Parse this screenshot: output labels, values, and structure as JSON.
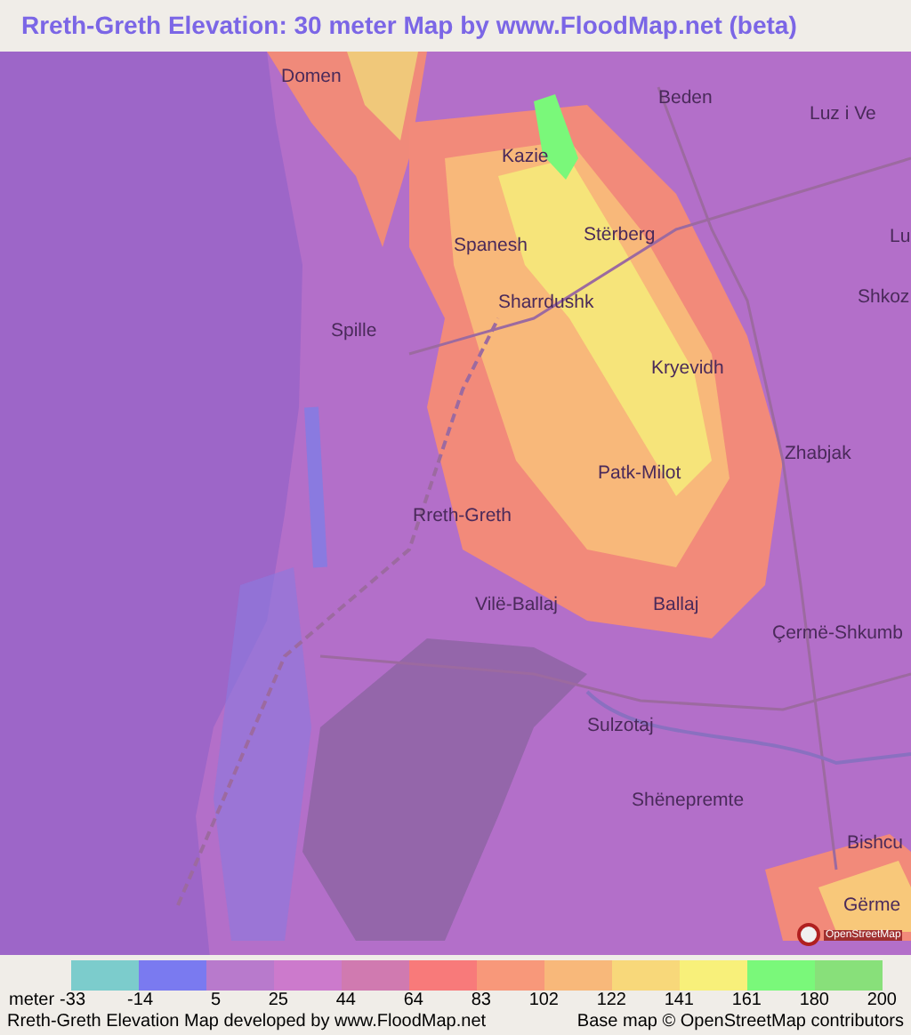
{
  "title": "Rreth-Greth Elevation: 30 meter Map by www.FloodMap.net (beta)",
  "map": {
    "places": [
      {
        "name": "Domen"
      },
      {
        "name": "Beden"
      },
      {
        "name": "Luz i Ve"
      },
      {
        "name": "Kazie"
      },
      {
        "name": "Lu"
      },
      {
        "name": "Spanesh"
      },
      {
        "name": "Stërberg"
      },
      {
        "name": "Shkoz"
      },
      {
        "name": "Sharrdushk"
      },
      {
        "name": "Spille"
      },
      {
        "name": "Kryevidh"
      },
      {
        "name": "Zhabjak"
      },
      {
        "name": "Patk-Milot"
      },
      {
        "name": "Rreth-Greth"
      },
      {
        "name": "Vilë-Ballaj"
      },
      {
        "name": "Ballaj"
      },
      {
        "name": "Çermë-Shkumb"
      },
      {
        "name": "Sulzotaj"
      },
      {
        "name": "Shënepremte"
      },
      {
        "name": "Bishcu"
      },
      {
        "name": "Gërme"
      }
    ],
    "attribution_logo": "OpenStreetMap"
  },
  "legend": {
    "unit": "meter",
    "swatches": [
      {
        "color": "#7ccccc"
      },
      {
        "color": "#7a7af0"
      },
      {
        "color": "#b87acc"
      },
      {
        "color": "#cc7acc"
      },
      {
        "color": "#d07ab0"
      },
      {
        "color": "#f87a7a"
      },
      {
        "color": "#f8987a"
      },
      {
        "color": "#f8b87a"
      },
      {
        "color": "#f8d87a"
      },
      {
        "color": "#f8f07a"
      },
      {
        "color": "#7af87a"
      },
      {
        "color": "#88e07a"
      }
    ],
    "labels": [
      "-33",
      "-14",
      "5",
      "25",
      "44",
      "64",
      "83",
      "102",
      "122",
      "141",
      "161",
      "180",
      "200"
    ]
  },
  "footer": {
    "left": "Rreth-Greth Elevation Map developed by www.FloodMap.net",
    "right": "Base map © OpenStreetMap contributors"
  }
}
